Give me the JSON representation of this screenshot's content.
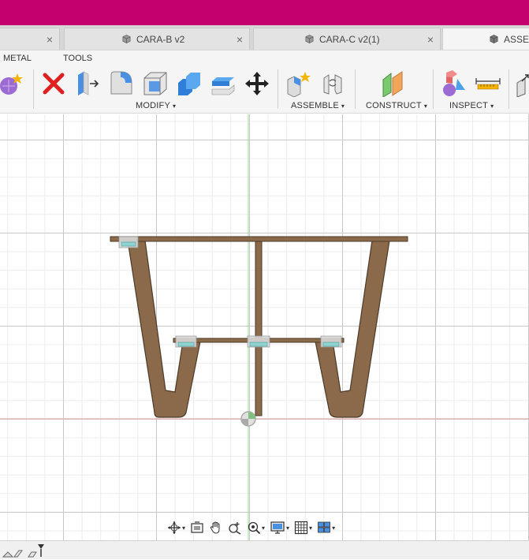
{
  "tabs": [
    {
      "label": "",
      "close": "×"
    },
    {
      "label": "CARA-B v2",
      "close": "×"
    },
    {
      "label": "CARA-C v2(1)",
      "close": "×"
    },
    {
      "label": "ASSE"
    }
  ],
  "toolbar": {
    "section_sheet_metal": "METAL",
    "section_tools": "TOOLS",
    "groups": {
      "modify": "MODIFY",
      "assemble": "ASSEMBLE",
      "construct": "CONSTRUCT",
      "inspect": "INSPECT"
    },
    "caret": "▾"
  },
  "colors": {
    "titlebar": "#c4006e",
    "wood": "#8a6a4a",
    "wood_dark": "#5c4630",
    "joint": "#8fd3d0"
  },
  "navbar": {
    "icons": [
      "orbit-icon",
      "look-at-icon",
      "pan-icon",
      "zoom-icon",
      "fit-icon",
      "display-settings-icon",
      "grid-settings-icon",
      "viewports-icon"
    ],
    "caret": "▾"
  }
}
